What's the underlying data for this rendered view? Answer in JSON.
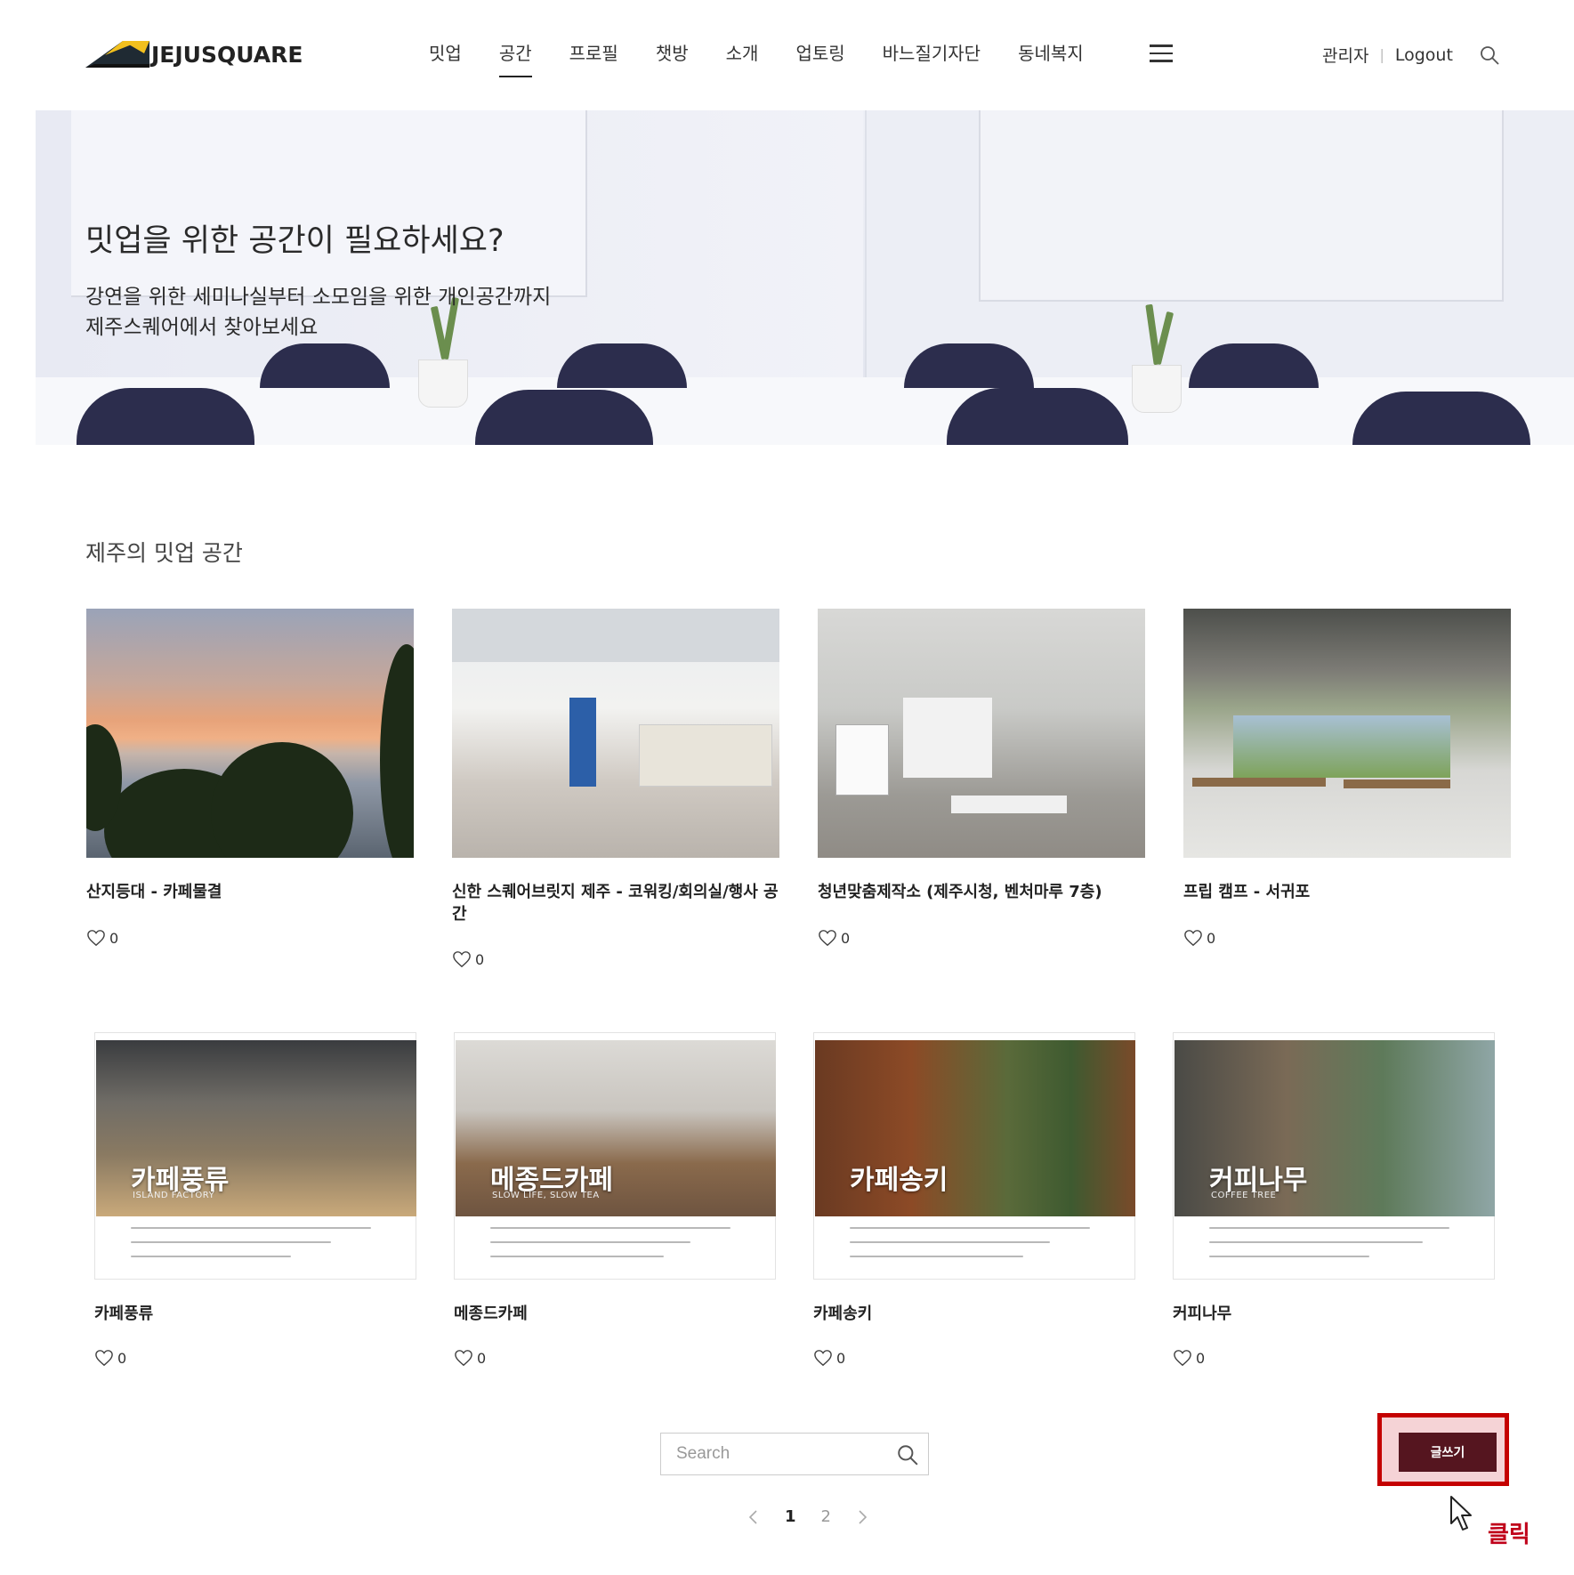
{
  "header": {
    "logo_text": "JEJUSQUARE",
    "nav": [
      {
        "label": "밋업",
        "active": false
      },
      {
        "label": "공간",
        "active": true
      },
      {
        "label": "프로필",
        "active": false
      },
      {
        "label": "챗방",
        "active": false
      },
      {
        "label": "소개",
        "active": false
      },
      {
        "label": "업토링",
        "active": false
      },
      {
        "label": "바느질기자단",
        "active": false
      },
      {
        "label": "동네복지",
        "active": false
      }
    ],
    "admin_label": "관리자",
    "separator": "|",
    "logout_label": "Logout"
  },
  "hero": {
    "title": "밋업을 위한 공간이 필요하세요?",
    "subtitle_line1": "강연을 위한 세미나실부터 소모임을 위한 개인공간까지",
    "subtitle_line2": "제주스퀘어에서 찾아보세요"
  },
  "section": {
    "title": "제주의 밋업 공간"
  },
  "cards": [
    {
      "title": "산지등대 - 카페물결",
      "likes": "0"
    },
    {
      "title": "신한 스퀘어브릿지 제주 - 코워킹/회의실/행사 공간",
      "likes": "0"
    },
    {
      "title": "청년맞춤제작소 (제주시청, 벤처마루 7층)",
      "likes": "0"
    },
    {
      "title": "프립 캠프 - 서귀포",
      "likes": "0"
    },
    {
      "title": "카페풍류",
      "likes": "0",
      "poster_name": "카페풍류",
      "poster_sub": "ISLAND FACTORY"
    },
    {
      "title": "메종드카페",
      "likes": "0",
      "poster_name": "메종드카페",
      "poster_sub": "SLOW LIFE, SLOW TEA"
    },
    {
      "title": "카페송키",
      "likes": "0",
      "poster_name": "카페송키",
      "poster_sub": ""
    },
    {
      "title": "커피나무",
      "likes": "0",
      "poster_name": "커피나무",
      "poster_sub": "COFFEE TREE"
    }
  ],
  "search": {
    "placeholder": "Search"
  },
  "pagination": {
    "pages": [
      "1",
      "2"
    ],
    "current": "1"
  },
  "write_button": {
    "label": "글쓰기"
  },
  "annotation": {
    "click_label": "클릭",
    "highlight_color": "#c40000"
  },
  "colors": {
    "write_button_bg": "#55151f",
    "accent_yellow": "#f2c01e",
    "logo_dark": "#1f2a33"
  }
}
